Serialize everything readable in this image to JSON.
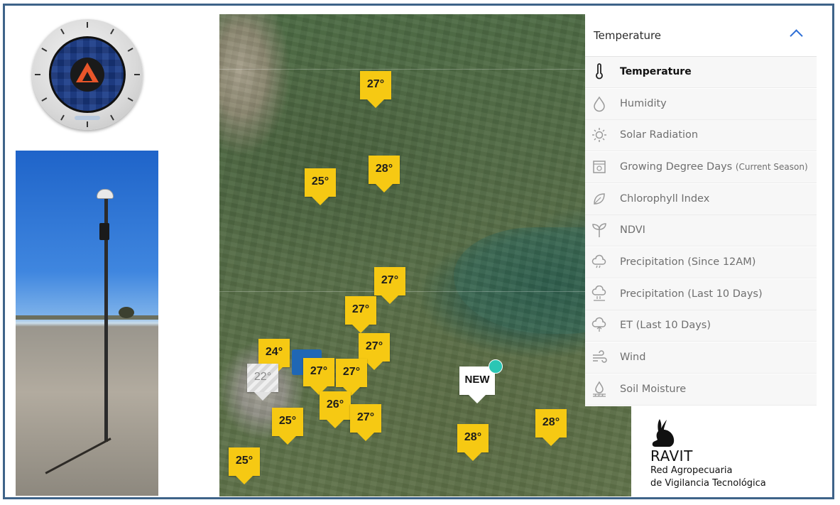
{
  "map": {
    "pins": [
      {
        "label": "27°",
        "style": "yellow"
      },
      {
        "label": "28°",
        "style": "yellow"
      },
      {
        "label": "25°",
        "style": "yellow"
      },
      {
        "label": "27°",
        "style": "yellow"
      },
      {
        "label": "27°",
        "style": "yellow"
      },
      {
        "label": "27°",
        "style": "yellow"
      },
      {
        "label": "24°",
        "style": "yellow"
      },
      {
        "label": "22°",
        "style": "grey"
      },
      {
        "label": "27°",
        "style": "yellow"
      },
      {
        "label": "27°",
        "style": "yellow"
      },
      {
        "label": "26°",
        "style": "yellow"
      },
      {
        "label": "27°",
        "style": "yellow"
      },
      {
        "label": "25°",
        "style": "yellow"
      },
      {
        "label": "28°",
        "style": "yellow"
      },
      {
        "label": "28°",
        "style": "yellow"
      },
      {
        "label": "25°",
        "style": "yellow"
      },
      {
        "label": "NEW",
        "style": "new"
      }
    ],
    "colors": {
      "pin": "#f6c913",
      "new_dot": "#2bc6b4",
      "station_block": "#1f67b5"
    }
  },
  "dropdown": {
    "selected": "Temperature",
    "accent": "#2e6fd6",
    "items": [
      {
        "label": "Temperature",
        "icon": "thermometer-icon",
        "active": true
      },
      {
        "label": "Humidity",
        "icon": "droplet-icon"
      },
      {
        "label": "Solar Radiation",
        "icon": "sun-icon"
      },
      {
        "label": "Growing Degree Days",
        "suffix": "(Current Season)",
        "icon": "calendar-icon"
      },
      {
        "label": "Chlorophyll Index",
        "icon": "leaf-icon"
      },
      {
        "label": "NDVI",
        "icon": "sprout-icon"
      },
      {
        "label": "Precipitation (Since 12AM)",
        "icon": "rain-cloud-icon"
      },
      {
        "label": "Precipitation (Last 10 Days)",
        "icon": "rain-cloud-calendar-icon"
      },
      {
        "label": "ET (Last 10 Days)",
        "icon": "evapotranspiration-icon"
      },
      {
        "label": "Wind",
        "icon": "wind-icon"
      },
      {
        "label": "Soil Moisture",
        "icon": "soil-moisture-icon"
      }
    ]
  },
  "logo": {
    "name": "RAVIT",
    "line1": "Red Agropecuaria",
    "line2": "de Vigilancia Tecnológica"
  }
}
